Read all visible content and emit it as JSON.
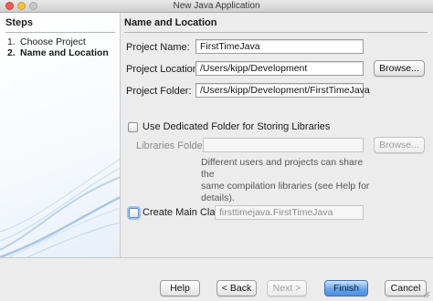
{
  "window": {
    "title": "New Java Application"
  },
  "steps": {
    "heading": "Steps",
    "items": [
      {
        "num": "1.",
        "label": "Choose Project"
      },
      {
        "num": "2.",
        "label": "Name and Location"
      }
    ]
  },
  "section": {
    "title": "Name and Location"
  },
  "project_name": {
    "label": "Project Name:",
    "value": "FirstTimeJava"
  },
  "project_location": {
    "label": "Project Location:",
    "value": "/Users/kipp/Development",
    "browse": "Browse..."
  },
  "project_folder": {
    "label": "Project Folder:",
    "value": "/Users/kipp/Development/FirstTimeJava"
  },
  "libraries": {
    "checkbox_label": "Use Dedicated Folder for Storing Libraries",
    "checked": false,
    "folder_label": "Libraries Folder:",
    "folder_value": "",
    "browse": "Browse...",
    "help_line1": "Different users and projects can share the",
    "help_line2": "same compilation libraries (see Help for",
    "help_line3": "details)."
  },
  "main_class": {
    "checkbox_label": "Create Main Class",
    "checked": false,
    "value": "firsttimejava.FirstTimeJava"
  },
  "buttons": {
    "help": "Help",
    "back": "< Back",
    "next": "Next >",
    "finish": "Finish",
    "cancel": "Cancel"
  },
  "colors": {
    "default_button": "#6aa6ea",
    "steps_bg": "#f7fafd",
    "window_bg": "#ececec"
  }
}
